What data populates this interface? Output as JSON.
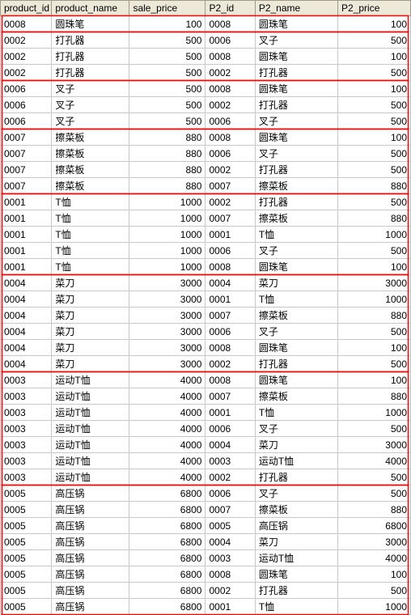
{
  "columns": [
    "product_id",
    "product_name",
    "sale_price",
    "P2_id",
    "P2_name",
    "P2_price"
  ],
  "rows": [
    [
      "0008",
      "圆珠笔",
      100,
      "0008",
      "圆珠笔",
      100
    ],
    [
      "0002",
      "打孔器",
      500,
      "0006",
      "叉子",
      500
    ],
    [
      "0002",
      "打孔器",
      500,
      "0008",
      "圆珠笔",
      100
    ],
    [
      "0002",
      "打孔器",
      500,
      "0002",
      "打孔器",
      500
    ],
    [
      "0006",
      "叉子",
      500,
      "0008",
      "圆珠笔",
      100
    ],
    [
      "0006",
      "叉子",
      500,
      "0002",
      "打孔器",
      500
    ],
    [
      "0006",
      "叉子",
      500,
      "0006",
      "叉子",
      500
    ],
    [
      "0007",
      "擦菜板",
      880,
      "0008",
      "圆珠笔",
      100
    ],
    [
      "0007",
      "擦菜板",
      880,
      "0006",
      "叉子",
      500
    ],
    [
      "0007",
      "擦菜板",
      880,
      "0002",
      "打孔器",
      500
    ],
    [
      "0007",
      "擦菜板",
      880,
      "0007",
      "擦菜板",
      880
    ],
    [
      "0001",
      "T恤",
      1000,
      "0002",
      "打孔器",
      500
    ],
    [
      "0001",
      "T恤",
      1000,
      "0007",
      "擦菜板",
      880
    ],
    [
      "0001",
      "T恤",
      1000,
      "0001",
      "T恤",
      1000
    ],
    [
      "0001",
      "T恤",
      1000,
      "0006",
      "叉子",
      500
    ],
    [
      "0001",
      "T恤",
      1000,
      "0008",
      "圆珠笔",
      100
    ],
    [
      "0004",
      "菜刀",
      3000,
      "0004",
      "菜刀",
      3000
    ],
    [
      "0004",
      "菜刀",
      3000,
      "0001",
      "T恤",
      1000
    ],
    [
      "0004",
      "菜刀",
      3000,
      "0007",
      "擦菜板",
      880
    ],
    [
      "0004",
      "菜刀",
      3000,
      "0006",
      "叉子",
      500
    ],
    [
      "0004",
      "菜刀",
      3000,
      "0008",
      "圆珠笔",
      100
    ],
    [
      "0004",
      "菜刀",
      3000,
      "0002",
      "打孔器",
      500
    ],
    [
      "0003",
      "运动T恤",
      4000,
      "0008",
      "圆珠笔",
      100
    ],
    [
      "0003",
      "运动T恤",
      4000,
      "0007",
      "擦菜板",
      880
    ],
    [
      "0003",
      "运动T恤",
      4000,
      "0001",
      "T恤",
      1000
    ],
    [
      "0003",
      "运动T恤",
      4000,
      "0006",
      "叉子",
      500
    ],
    [
      "0003",
      "运动T恤",
      4000,
      "0004",
      "菜刀",
      3000
    ],
    [
      "0003",
      "运动T恤",
      4000,
      "0003",
      "运动T恤",
      4000
    ],
    [
      "0003",
      "运动T恤",
      4000,
      "0002",
      "打孔器",
      500
    ],
    [
      "0005",
      "高压锅",
      6800,
      "0006",
      "叉子",
      500
    ],
    [
      "0005",
      "高压锅",
      6800,
      "0007",
      "擦菜板",
      880
    ],
    [
      "0005",
      "高压锅",
      6800,
      "0005",
      "高压锅",
      6800
    ],
    [
      "0005",
      "高压锅",
      6800,
      "0004",
      "菜刀",
      3000
    ],
    [
      "0005",
      "高压锅",
      6800,
      "0003",
      "运动T恤",
      4000
    ],
    [
      "0005",
      "高压锅",
      6800,
      "0008",
      "圆珠笔",
      100
    ],
    [
      "0005",
      "高压锅",
      6800,
      "0002",
      "打孔器",
      500
    ],
    [
      "0005",
      "高压锅",
      6800,
      "0001",
      "T恤",
      1000
    ]
  ],
  "box_row_ranges": [
    [
      0,
      0
    ],
    [
      1,
      3
    ],
    [
      4,
      6
    ],
    [
      7,
      10
    ],
    [
      11,
      15
    ],
    [
      16,
      21
    ],
    [
      22,
      28
    ],
    [
      29,
      36
    ]
  ],
  "box_color": "#ff0000"
}
